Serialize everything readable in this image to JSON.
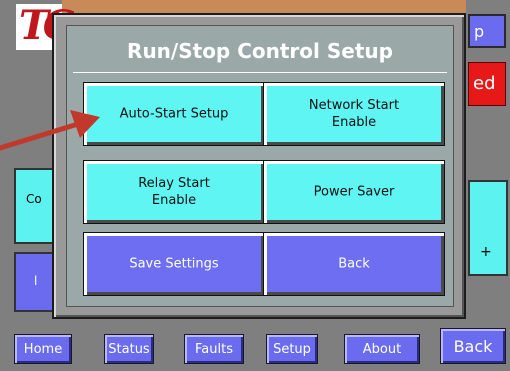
{
  "dialog": {
    "title": "Run/Stop Control Setup",
    "buttons": {
      "auto_start": "Auto-Start Setup",
      "network_start": "Network Start\nEnable",
      "relay_start": "Relay Start\nEnable",
      "power_saver": "Power Saver",
      "save_settings": "Save Settings",
      "back": "Back"
    }
  },
  "background": {
    "logo_text": "TC",
    "top_right_button_fragment": "p",
    "status_fragment": "ed",
    "left_cyan_fragment": "Co",
    "right_cyan_fragment": "+"
  },
  "nav": {
    "home": "Home",
    "status": "Status",
    "faults": "Faults",
    "setup": "Setup",
    "about": "About",
    "back": "Back"
  },
  "colors": {
    "cyan_button": "#5ef5f2",
    "blue_button": "#6e6ef2",
    "dialog_face": "#9aa8a7",
    "status_red": "#e61818",
    "annotation_arrow": "#c0392b"
  }
}
